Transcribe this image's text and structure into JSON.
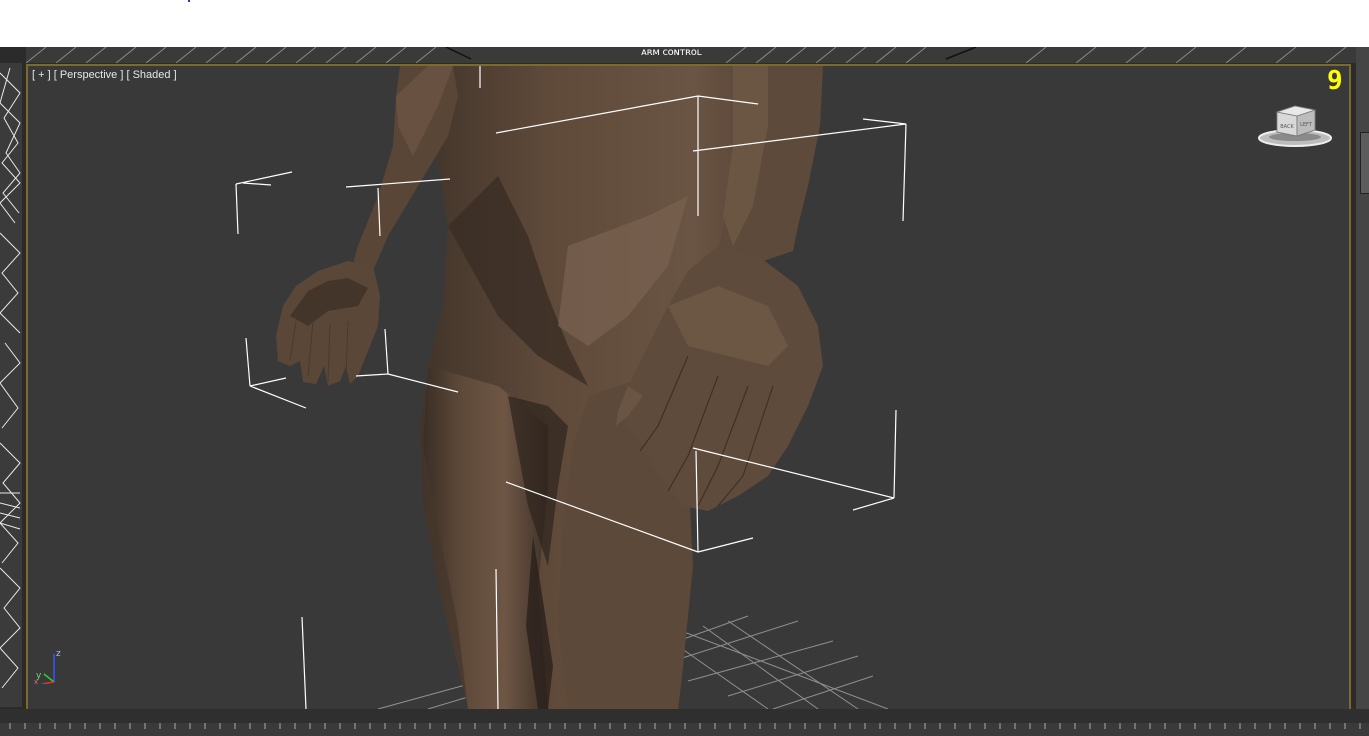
{
  "viewport": {
    "label_parts": [
      "[ + ]",
      "[ Perspective ]",
      "[ Shaded ]"
    ],
    "number": "9",
    "top_strip_text": "ᴀʀᴍ ᴄᴏɴᴛʀᴏʟ"
  },
  "viewcube": {
    "face_left": "BACK",
    "face_right": "LEFT"
  },
  "axis": {
    "x": "x",
    "y": "y",
    "z": "z"
  },
  "colors": {
    "viewport_bg": "#393939",
    "viewport_border": "#7a6a2c",
    "viewport_number": "#ffff00",
    "skin": "#5e4b3b",
    "wireframe": "#ffffff"
  }
}
